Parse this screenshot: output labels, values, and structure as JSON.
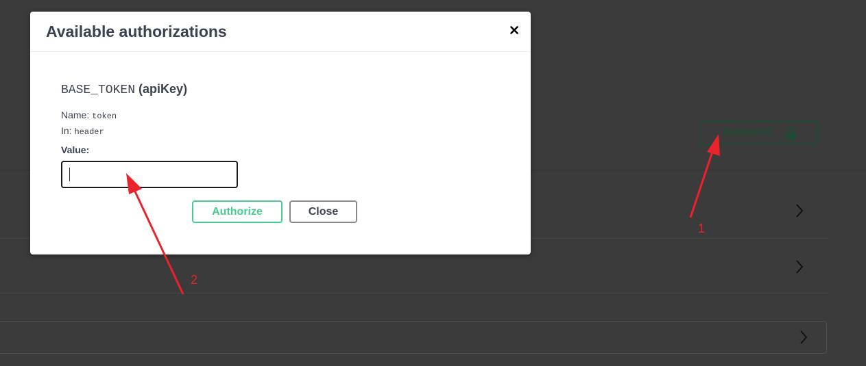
{
  "background": {
    "authorize_button_label": "Authorize",
    "lock_icon": "lock-icon",
    "row_chevron_icon": "chevron-right-icon"
  },
  "modal": {
    "title": "Available authorizations",
    "close_icon": "close-icon",
    "scheme": {
      "name": "BASE_TOKEN",
      "type": "(apiKey)",
      "name_label": "Name:",
      "name_value": "token",
      "in_label": "In:",
      "in_value": "header",
      "value_label": "Value:",
      "value_input": ""
    },
    "buttons": {
      "authorize": "Authorize",
      "close": "Close"
    }
  },
  "annotations": {
    "marker_1": "1",
    "marker_2": "2",
    "color": "#e8232b"
  },
  "colors": {
    "authorize_green": "#49cc90",
    "text_dark": "#3b4151",
    "overlay": "#3b3b3b"
  }
}
